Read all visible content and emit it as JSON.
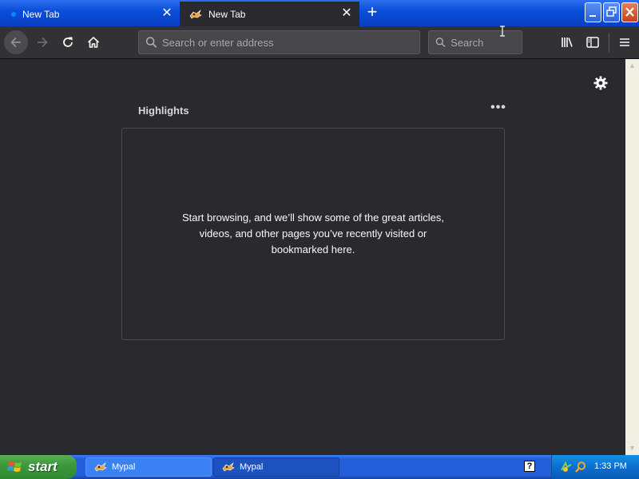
{
  "tabs": [
    {
      "label": "New Tab",
      "active": false
    },
    {
      "label": "New Tab",
      "active": true
    }
  ],
  "window_controls": {
    "minimize": "_",
    "maximize": "❐",
    "close": "✕"
  },
  "nav": {
    "address_placeholder": "Search or enter address",
    "search_placeholder": "Search"
  },
  "highlights": {
    "title": "Highlights",
    "menu_label": "•••",
    "empty_message": "Start browsing, and we’ll show some of the great articles, videos, and other pages you’ve recently visited or bookmarked here."
  },
  "taskbar": {
    "start_label": "start",
    "tasks": [
      {
        "label": "Mypal"
      },
      {
        "label": "Mypal"
      }
    ],
    "help_label": "?",
    "clock": "1:33 PM"
  },
  "colors": {
    "content_bg": "#2a2a2e",
    "toolbar_bg": "#323234",
    "xp_blue": "#245edb",
    "start_green": "#3c9a3c"
  }
}
